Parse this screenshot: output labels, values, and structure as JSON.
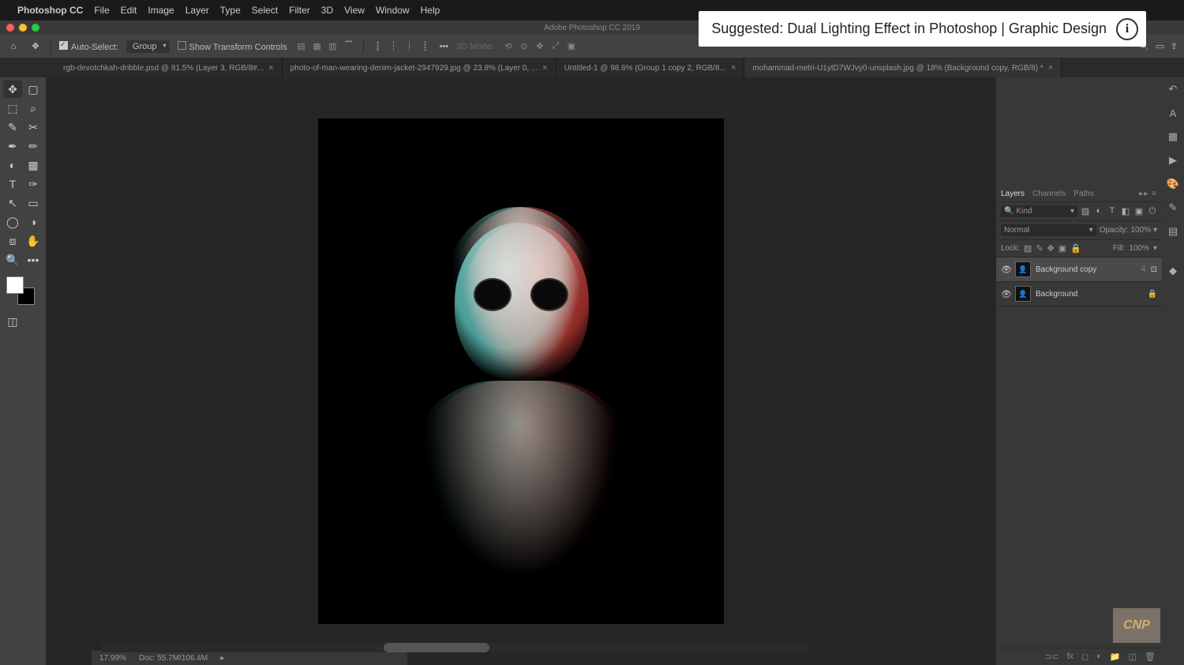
{
  "menubar": {
    "app": "Photoshop CC",
    "items": [
      "File",
      "Edit",
      "Image",
      "Layer",
      "Type",
      "Select",
      "Filter",
      "3D",
      "View",
      "Window",
      "Help"
    ]
  },
  "suggested": {
    "text": "Suggested: Dual Lighting Effect in Photoshop | Graphic Design"
  },
  "window": {
    "title": "Adobe Photoshop CC 2019"
  },
  "options": {
    "autoSelect": "Auto-Select:",
    "group": "Group",
    "showTransform": "Show Transform Controls",
    "threeDMode": "3D Mode:"
  },
  "tabs": [
    {
      "label": "rgb-devotchkah-dribble.psd @ 81.5% (Layer 3, RGB/8#...",
      "active": false
    },
    {
      "label": "photo-of-man-wearing-denim-jacket-2947929.jpg @ 23.8% (Layer 0, ...",
      "active": false
    },
    {
      "label": "Untitled-1 @ 98.6% (Group 1 copy 2, RGB/8...",
      "active": false
    },
    {
      "label": "mohammad-metri-U1ytD7WJvy0-unsplash.jpg @ 18% (Background copy, RGB/8) *",
      "active": true
    }
  ],
  "layersPanel": {
    "tabs": [
      "Layers",
      "Channels",
      "Paths"
    ],
    "kind": "Kind",
    "blend": "Normal",
    "opacityLabel": "Opacity:",
    "opacityVal": "100%",
    "lockLabel": "Lock:",
    "fillLabel": "Fill:",
    "fillVal": "100%",
    "layers": [
      {
        "name": "Background copy",
        "locked": false,
        "selected": true
      },
      {
        "name": "Background",
        "locked": true,
        "selected": false
      }
    ]
  },
  "status": {
    "zoom": "17.99%",
    "doc": "Doc: 55.7M/106.4M"
  },
  "cnp": "CNP"
}
